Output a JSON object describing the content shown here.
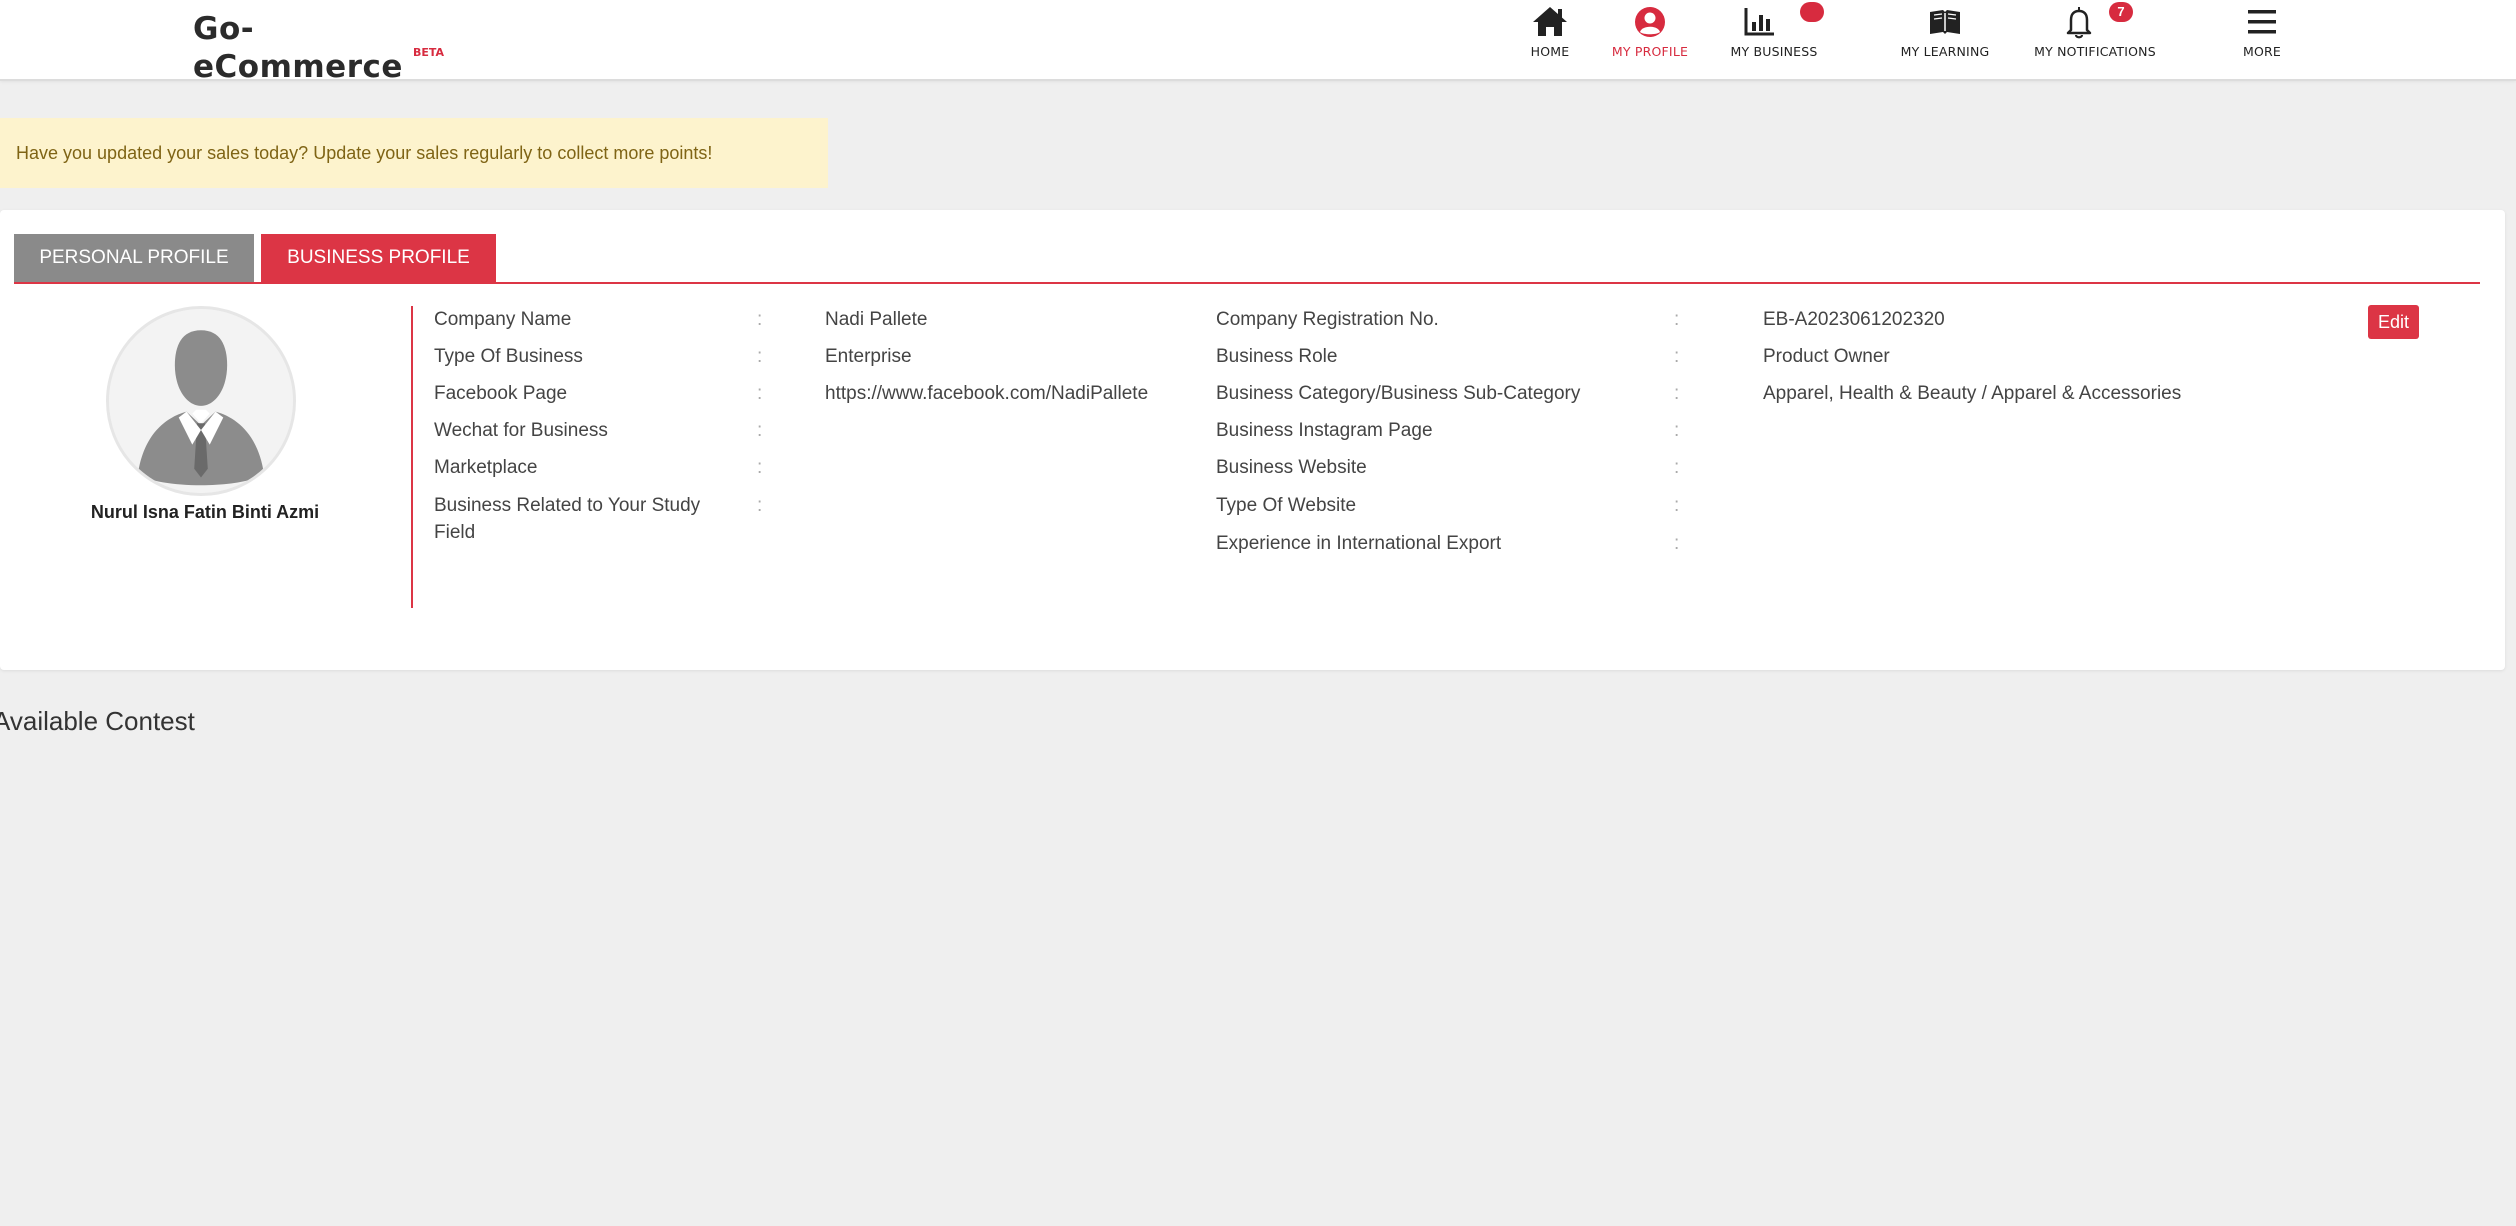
{
  "brand": {
    "name": "Go-eCommerce",
    "tag": "BETA"
  },
  "nav": {
    "items": [
      {
        "label": "HOME",
        "icon": "home-icon"
      },
      {
        "label": "MY PROFILE",
        "icon": "user-circle-icon",
        "active": true
      },
      {
        "label": "MY BUSINESS",
        "icon": "bar-chart-icon",
        "badge": ""
      },
      {
        "label": "MY LEARNING",
        "icon": "book-icon"
      },
      {
        "label": "MY NOTIFICATIONS",
        "icon": "bell-icon",
        "badge": "7"
      },
      {
        "label": "MORE",
        "icon": "menu-icon"
      }
    ]
  },
  "alert": {
    "text": "Have you updated your sales today? Update your sales regularly to collect more points!"
  },
  "profile": {
    "tabs": {
      "personal": "PERSONAL PROFILE",
      "business": "BUSINESS PROFILE"
    },
    "user_name": "Nurul Isna Fatin Binti Azmi",
    "edit_label": "Edit",
    "separator": ":",
    "left_fields": [
      {
        "label": "Company Name",
        "value": "Nadi Pallete"
      },
      {
        "label": "Type Of Business",
        "value": "Enterprise"
      },
      {
        "label": "Facebook Page",
        "value": "https://www.facebook.com/NadiPallete"
      },
      {
        "label": "Wechat for Business",
        "value": ""
      },
      {
        "label": "Marketplace",
        "value": ""
      },
      {
        "label": "Business Related to Your Study Field",
        "value": ""
      }
    ],
    "right_fields": [
      {
        "label": "Company Registration No.",
        "value": "EB-A2023061202320"
      },
      {
        "label": "Business Role",
        "value": "Product Owner"
      },
      {
        "label": "Business Category/Business Sub-Category",
        "value": "Apparel, Health & Beauty / Apparel & Accessories"
      },
      {
        "label": "Business Instagram Page",
        "value": ""
      },
      {
        "label": "Business Website",
        "value": ""
      },
      {
        "label": "Type Of Website",
        "value": ""
      },
      {
        "label": "Experience in International Export",
        "value": ""
      }
    ]
  },
  "contest": {
    "title": "Available Contest"
  },
  "colors": {
    "accent": "#dc3545",
    "tab_inactive": "#8a8a8a",
    "alert_bg": "#fdf3cd",
    "alert_text": "#7f6415",
    "page_bg": "#efefef"
  }
}
